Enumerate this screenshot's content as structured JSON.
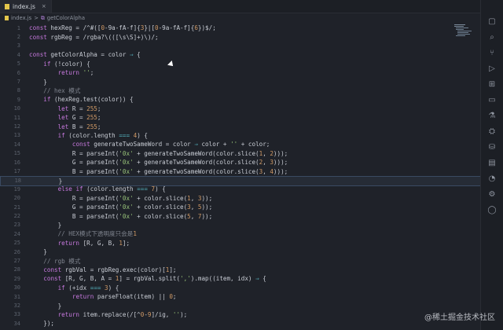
{
  "tab": {
    "filename": "index.js",
    "close": "×"
  },
  "breadcrumb": {
    "file": "index.js",
    "sep": ">",
    "symbol": "getColorAlpha"
  },
  "watermark": "@稀土掘金技术社区",
  "lines": [
    {
      "n": "1",
      "h": "const hexReg = /^#([0-9a-fA-f]{3}|[0-9a-fA-f]{6})$/;"
    },
    {
      "n": "2",
      "h": "const rgbReg = /rgba?\\(([\\s\\S]+)\\)/;"
    },
    {
      "n": "3",
      "h": ""
    },
    {
      "n": "4",
      "h": "const getColorAlpha = color ⇒ {"
    },
    {
      "n": "5",
      "h": "    if (!color) {"
    },
    {
      "n": "6",
      "h": "        return '';"
    },
    {
      "n": "7",
      "h": "    }"
    },
    {
      "n": "8",
      "h": "    // hex 模式"
    },
    {
      "n": "9",
      "h": "    if (hexReg.test(color)) {"
    },
    {
      "n": "10",
      "h": "        let R = 255;"
    },
    {
      "n": "11",
      "h": "        let G = 255;"
    },
    {
      "n": "12",
      "h": "        let B = 255;"
    },
    {
      "n": "13",
      "h": "        if (color.length === 4) {"
    },
    {
      "n": "14",
      "h": "            const generateTwoSameWord = color ⇒ color + '' + color;"
    },
    {
      "n": "15",
      "h": "            R = parseInt('0x' + generateTwoSameWord(color.slice(1, 2)));"
    },
    {
      "n": "16",
      "h": "            G = parseInt('0x' + generateTwoSameWord(color.slice(2, 3)));"
    },
    {
      "n": "17",
      "h": "            B = parseInt('0x' + generateTwoSameWord(color.slice(3, 4)));"
    },
    {
      "n": "18",
      "h": "        }"
    },
    {
      "n": "19",
      "h": "        else if (color.length === 7) {"
    },
    {
      "n": "20",
      "h": "            R = parseInt('0x' + color.slice(1, 3));"
    },
    {
      "n": "21",
      "h": "            G = parseInt('0x' + color.slice(3, 5));"
    },
    {
      "n": "22",
      "h": "            B = parseInt('0x' + color.slice(5, 7));"
    },
    {
      "n": "23",
      "h": "        }"
    },
    {
      "n": "24",
      "h": "        // HEX模式下透明度只会是1"
    },
    {
      "n": "25",
      "h": "        return [R, G, B, 1];"
    },
    {
      "n": "26",
      "h": "    }"
    },
    {
      "n": "27",
      "h": "    // rgb 模式"
    },
    {
      "n": "28",
      "h": "    const rgbVal = rgbReg.exec(color)[1];"
    },
    {
      "n": "29",
      "h": "    const [R, G, B, A = 1] = rgbVal.split(',').map((item, idx) ⇒ {"
    },
    {
      "n": "30",
      "h": "        if (+idx === 3) {"
    },
    {
      "n": "31",
      "h": "            return parseFloat(item) || 0;"
    },
    {
      "n": "32",
      "h": "        }"
    },
    {
      "n": "33",
      "h": "        return item.replace(/[^0-9]/ig, '');"
    },
    {
      "n": "34",
      "h": "    });"
    }
  ],
  "activeLine": 18,
  "icons": [
    "split-editor-icon",
    "more-icon",
    "explorer-icon",
    "search-icon",
    "source-control-icon",
    "debug-icon",
    "extensions-icon",
    "remote-icon",
    "test-icon",
    "docker-icon",
    "database-icon",
    "chart-icon",
    "timeline-icon",
    "settings-icon",
    "account-icon"
  ]
}
